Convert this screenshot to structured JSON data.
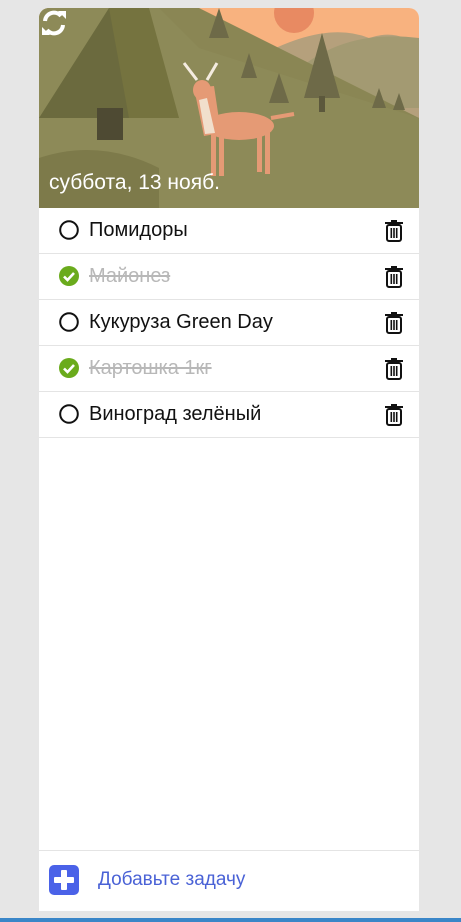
{
  "header": {
    "date": "суббота, 13 нояб.",
    "refresh_icon": "refresh-icon"
  },
  "tasks": [
    {
      "label": "Помидоры",
      "done": false
    },
    {
      "label": "Майонез",
      "done": true
    },
    {
      "label": "Кукуруза Green Day",
      "done": false
    },
    {
      "label": "Картошка 1кг",
      "done": true
    },
    {
      "label": "Виноград зелёный",
      "done": false
    }
  ],
  "footer": {
    "add_label": "Добавьте задачу"
  },
  "colors": {
    "accent": "#4a62e8",
    "done": "#6aab1c",
    "bottom_bar": "#3a86c8"
  }
}
